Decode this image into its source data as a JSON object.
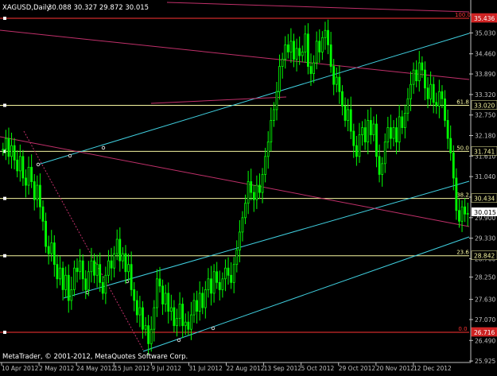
{
  "header": {
    "symbol_label": "XAGUSD,Daily",
    "ohlc_label": "30.088 30.327 29.872 30.015"
  },
  "footer": {
    "copyright": "MetaTrader, © 2001-2012, MetaQuotes Software Corp."
  },
  "colors": {
    "background": "#000000",
    "candle": "#00ff00",
    "axis": "#c0c0c0",
    "fib_level": "#f5f5a0",
    "fib_extreme": "#ff3333",
    "channel_cyan": "#40d0e0",
    "channel_magenta": "#c0306a",
    "current_price_bg": "#ffffff"
  },
  "chart_data": {
    "type": "candlestick",
    "symbol": "XAGUSD",
    "timeframe": "Daily",
    "y_range": [
      25.9,
      35.9
    ],
    "y_ticks": [
      35.03,
      34.45,
      33.89,
      33.32,
      32.75,
      32.18,
      31.61,
      31.04,
      30.47,
      29.9,
      29.33,
      28.76,
      28.25,
      27.63,
      27.07,
      26.49,
      25.92
    ],
    "y_tick_labels": [
      "35.030",
      "34.460",
      "33.890",
      "33.320",
      "32.750",
      "32.180",
      "31.610",
      "31.040",
      "30.470",
      "29.900",
      "29.330",
      "28.760",
      "28.250",
      "27.630",
      "27.070",
      "26.490",
      "25.925"
    ],
    "x_labels": [
      "10 Apr 2012",
      "2 May 2012",
      "24 May 2012",
      "15 Jun 2012",
      "9 Jul 2012",
      "31 Jul 2012",
      "22 Aug 2012",
      "13 Sep 2012",
      "5 Oct 2012",
      "29 Oct 2012",
      "20 Nov 2012",
      "12 Dec 2012"
    ],
    "closes": [
      31.8,
      32.1,
      31.6,
      31.9,
      31.5,
      31.2,
      31.6,
      31.0,
      30.8,
      31.3,
      30.9,
      30.4,
      30.8,
      30.2,
      29.8,
      29.1,
      28.9,
      29.2,
      28.6,
      28.2,
      28.5,
      27.9,
      28.3,
      27.6,
      27.9,
      28.5,
      28.4,
      28.7,
      28.2,
      27.9,
      28.4,
      28.7,
      28.3,
      28.6,
      28.1,
      27.8,
      28.3,
      28.7,
      28.5,
      28.9,
      29.3,
      28.7,
      28.9,
      28.4,
      28.6,
      27.9,
      27.6,
      27.2,
      27.4,
      26.8,
      26.9,
      26.4,
      26.8,
      27.4,
      28.2,
      28.0,
      27.5,
      27.8,
      27.3,
      27.4,
      26.9,
      27.1,
      27.5,
      26.9,
      27.0,
      26.8,
      27.2,
      27.6,
      27.3,
      27.8,
      27.4,
      27.9,
      28.2,
      27.8,
      28.4,
      28.1,
      27.9,
      28.2,
      28.5,
      28.3,
      28.1,
      28.6,
      29.0,
      29.5,
      29.9,
      30.3,
      30.9,
      30.6,
      30.4,
      30.8,
      30.6,
      31.1,
      31.6,
      32.0,
      32.6,
      32.9,
      33.4,
      34.1,
      34.3,
      34.7,
      34.5,
      34.8,
      34.3,
      34.6,
      34.4,
      34.5,
      35.0,
      34.1,
      33.9,
      34.2,
      34.8,
      34.5,
      34.9,
      35.1,
      34.7,
      34.1,
      33.6,
      33.8,
      33.4,
      33.0,
      32.6,
      32.9,
      32.3,
      31.9,
      31.6,
      32.2,
      32.4,
      32.0,
      32.6,
      32.2,
      32.5,
      31.6,
      31.1,
      31.4,
      32.0,
      32.4,
      32.1,
      32.4,
      32.0,
      32.7,
      32.4,
      32.8,
      33.2,
      33.6,
      34.0,
      33.7,
      34.2,
      34.0,
      33.5,
      33.2,
      33.6,
      33.1,
      33.0,
      33.4,
      33.2,
      32.6,
      32.1,
      31.7,
      31.0,
      30.1,
      29.8,
      30.2,
      30.0,
      30.015
    ],
    "current_price": "30.015",
    "fibonacci": {
      "levels": [
        {
          "label": "100.0",
          "price_label": "35.436",
          "extreme": true
        },
        {
          "label": "61.8",
          "price_label": "33.020",
          "extreme": false
        },
        {
          "label": "50.0",
          "price_label": "31.741",
          "extreme": false
        },
        {
          "label": "38.2",
          "price_label": "30.434",
          "extreme": false
        },
        {
          "label": "23.6",
          "price_label": "28.842",
          "extreme": false
        },
        {
          "label": "0.0",
          "price_label": "26.716",
          "extreme": true
        }
      ],
      "values": [
        35.436,
        33.02,
        31.741,
        30.434,
        28.842,
        26.716
      ]
    },
    "grid": false
  }
}
